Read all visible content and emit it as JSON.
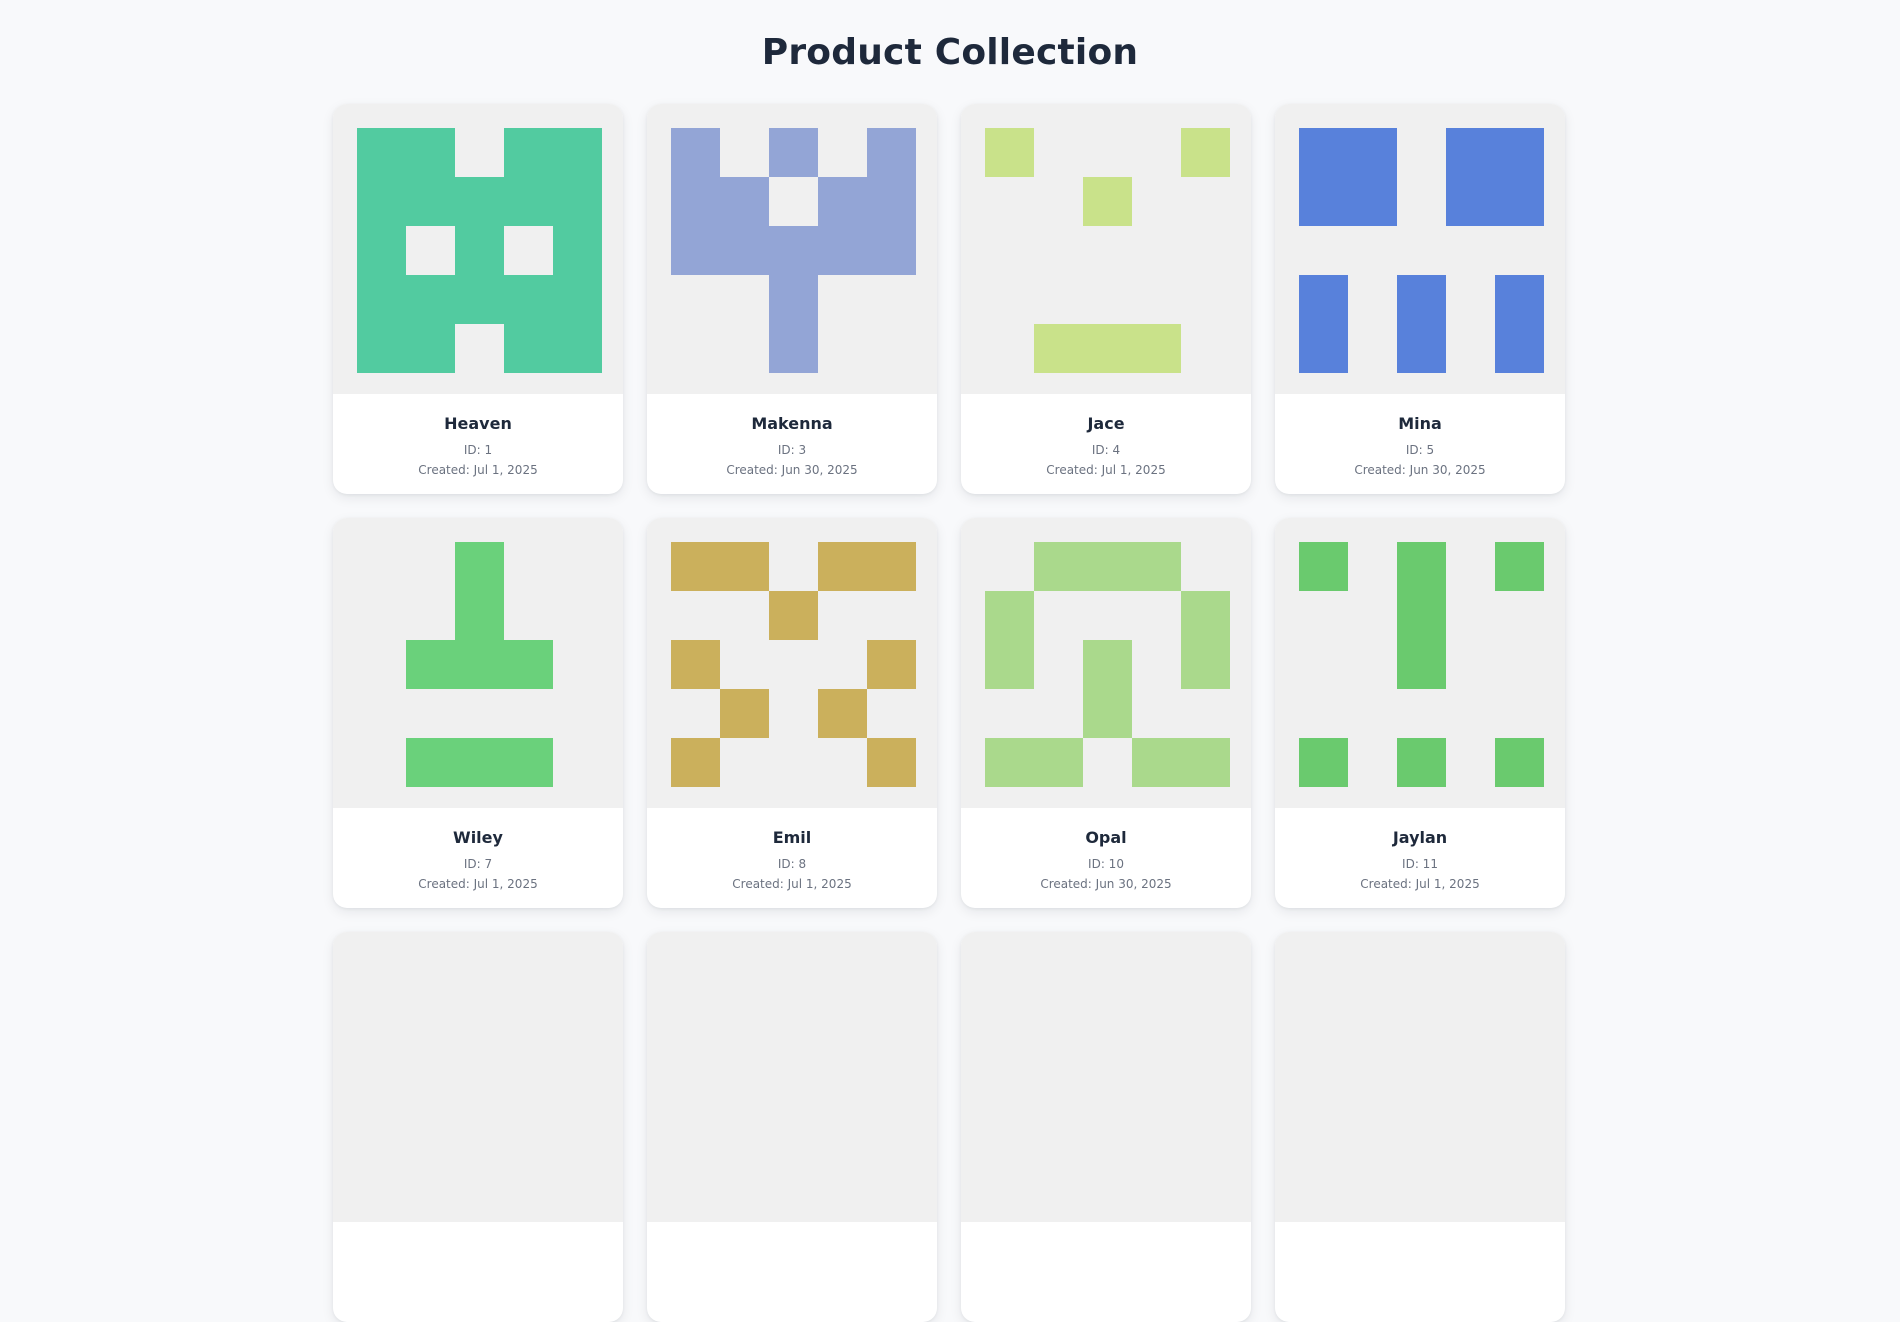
{
  "page": {
    "title": "Product Collection"
  },
  "products": [
    {
      "name": "Heaven",
      "id_text": "ID: 1",
      "created_text": "Created: Jul 1, 2025",
      "color": "#52cba0",
      "pattern": [
        "11011",
        "11111",
        "10101",
        "11111",
        "11011"
      ]
    },
    {
      "name": "Makenna",
      "id_text": "ID: 3",
      "created_text": "Created: Jun 30, 2025",
      "color": "#93a5d6",
      "pattern": [
        "10101",
        "11011",
        "11111",
        "00100",
        "00100"
      ]
    },
    {
      "name": "Jace",
      "id_text": "ID: 4",
      "created_text": "Created: Jul 1, 2025",
      "color": "#c9e28a",
      "pattern": [
        "10001",
        "00100",
        "00000",
        "00000",
        "01110"
      ]
    },
    {
      "name": "Mina",
      "id_text": "ID: 5",
      "created_text": "Created: Jun 30, 2025",
      "color": "#5881db",
      "pattern": [
        "11011",
        "11011",
        "00000",
        "10101",
        "10101"
      ]
    },
    {
      "name": "Wiley",
      "id_text": "ID: 7",
      "created_text": "Created: Jul 1, 2025",
      "color": "#6ad17b",
      "pattern": [
        "00100",
        "00100",
        "01110",
        "00000",
        "01110"
      ]
    },
    {
      "name": "Emil",
      "id_text": "ID: 8",
      "created_text": "Created: Jul 1, 2025",
      "color": "#cbb05c",
      "pattern": [
        "11011",
        "00100",
        "10001",
        "01010",
        "10001"
      ]
    },
    {
      "name": "Opal",
      "id_text": "ID: 10",
      "created_text": "Created: Jun 30, 2025",
      "color": "#aad98c",
      "pattern": [
        "01110",
        "10001",
        "10101",
        "00100",
        "11011"
      ]
    },
    {
      "name": "Jaylan",
      "id_text": "ID: 11",
      "created_text": "Created: Jul 1, 2025",
      "color": "#6aca6e",
      "pattern": [
        "10101",
        "00100",
        "00100",
        "00000",
        "10101"
      ]
    },
    {
      "name": "",
      "id_text": "",
      "created_text": "",
      "color": "#cccccc",
      "pattern": [
        "00000",
        "00000",
        "00000",
        "00000",
        "00000"
      ]
    },
    {
      "name": "",
      "id_text": "",
      "created_text": "",
      "color": "#cccccc",
      "pattern": [
        "00000",
        "00000",
        "00000",
        "00000",
        "00000"
      ]
    },
    {
      "name": "",
      "id_text": "",
      "created_text": "",
      "color": "#cccccc",
      "pattern": [
        "00000",
        "00000",
        "00000",
        "00000",
        "00000"
      ]
    },
    {
      "name": "",
      "id_text": "",
      "created_text": "",
      "color": "#cccccc",
      "pattern": [
        "00000",
        "00000",
        "00000",
        "00000",
        "00000"
      ]
    }
  ]
}
